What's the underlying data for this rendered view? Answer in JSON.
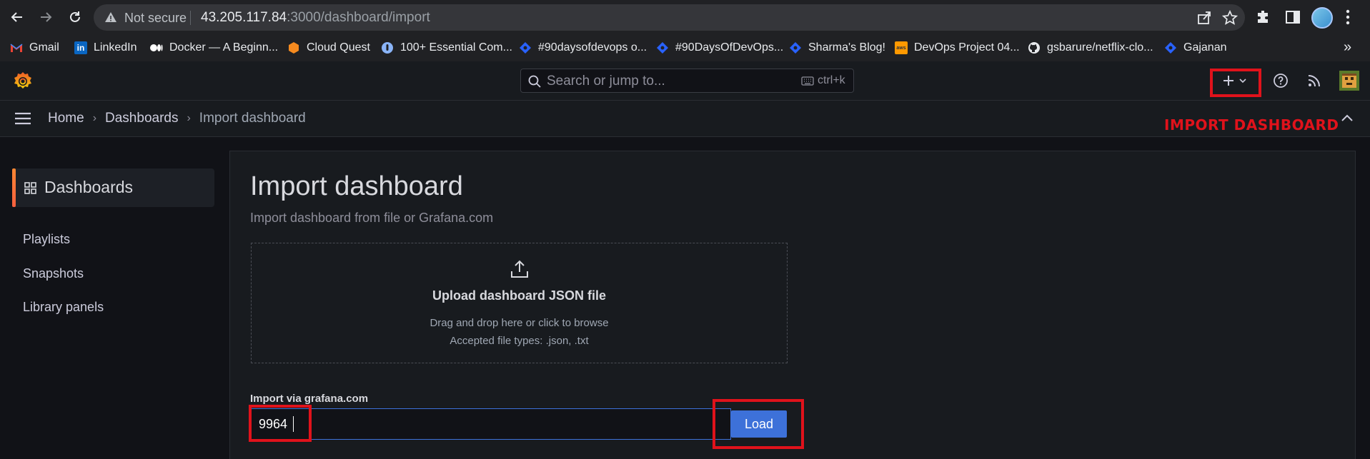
{
  "browser": {
    "security_label": "Not secure",
    "url_host": "43.205.117.84",
    "url_path": ":3000/dashboard/import",
    "bookmarks": [
      {
        "label": "Gmail",
        "icon": "gmail-icon"
      },
      {
        "label": "LinkedIn",
        "icon": "linkedin-icon"
      },
      {
        "label": "Docker — A Beginn...",
        "icon": "medium-icon"
      },
      {
        "label": "Cloud Quest",
        "icon": "cloud-quest-icon"
      },
      {
        "label": "100+ Essential Com...",
        "icon": "site-icon"
      },
      {
        "label": "#90daysofdevops o...",
        "icon": "hashnode-icon"
      },
      {
        "label": "#90DaysOfDevOps...",
        "icon": "hashnode-icon"
      },
      {
        "label": "Sharma's Blog!",
        "icon": "hashnode-icon"
      },
      {
        "label": "DevOps Project 04...",
        "icon": "aws-icon"
      },
      {
        "label": "gsbarure/netflix-clo...",
        "icon": "github-icon"
      },
      {
        "label": "Gajanan",
        "icon": "hashnode-icon"
      }
    ],
    "bookmarks_more": "»"
  },
  "grafana": {
    "search_placeholder": "Search or jump to...",
    "search_shortcut": "ctrl+k",
    "annotation": "IMPORT DASHBOARD",
    "breadcrumb": {
      "home": "Home",
      "dashboards": "Dashboards",
      "current": "Import dashboard",
      "separator": "›"
    },
    "sidebar": {
      "active": "Dashboards",
      "items": [
        "Playlists",
        "Snapshots",
        "Library panels"
      ]
    },
    "page": {
      "title": "Import dashboard",
      "subtitle": "Import dashboard from file or Grafana.com",
      "upload_title": "Upload dashboard JSON file",
      "upload_hint": "Drag and drop here or click to browse",
      "upload_types": "Accepted file types: .json, .txt",
      "via_label": "Import via grafana.com",
      "via_value": "9964",
      "load_label": "Load"
    },
    "colors": {
      "accent_blue": "#3d71d9",
      "annotation_red": "#e0121b",
      "active_bar": "#ff8833"
    }
  }
}
